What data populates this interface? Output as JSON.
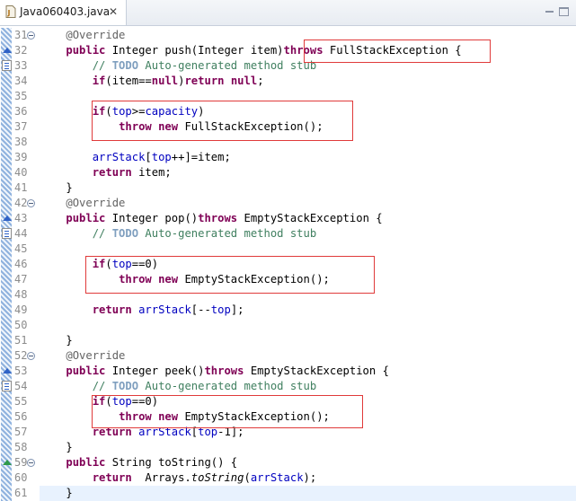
{
  "tab": {
    "title": "Java060403.java",
    "close": "✕"
  },
  "lines": [
    {
      "n": "31",
      "fold": true,
      "tokens": [
        [
          "    ",
          ""
        ],
        [
          "@Override",
          "an"
        ]
      ]
    },
    {
      "n": "32",
      "ovr": "ovr",
      "tokens": [
        [
          "    ",
          ""
        ],
        [
          "public",
          "kw"
        ],
        [
          " Integer push(Integer item)",
          ""
        ],
        [
          "throws",
          "kw"
        ],
        [
          " FullStackException {",
          ""
        ]
      ]
    },
    {
      "n": "33",
      "task": true,
      "tokens": [
        [
          "        ",
          ""
        ],
        [
          "// ",
          "cm"
        ],
        [
          "TODO",
          "td"
        ],
        [
          " Auto-generated method stub",
          "cm"
        ]
      ]
    },
    {
      "n": "34",
      "tokens": [
        [
          "        ",
          ""
        ],
        [
          "if",
          "kw"
        ],
        [
          "(item==",
          ""
        ],
        [
          "null",
          "kw"
        ],
        [
          ")",
          ""
        ],
        [
          "return",
          "kw"
        ],
        [
          " ",
          ""
        ],
        [
          "null",
          "kw"
        ],
        [
          ";",
          ""
        ]
      ]
    },
    {
      "n": "35",
      "tokens": []
    },
    {
      "n": "36",
      "tokens": [
        [
          "        ",
          ""
        ],
        [
          "if",
          "kw"
        ],
        [
          "(",
          ""
        ],
        [
          "top",
          "fd"
        ],
        [
          ">=",
          ""
        ],
        [
          "capacity",
          "fd"
        ],
        [
          ")",
          ""
        ]
      ]
    },
    {
      "n": "37",
      "tokens": [
        [
          "            ",
          ""
        ],
        [
          "throw",
          "kw"
        ],
        [
          " ",
          ""
        ],
        [
          "new",
          "kw"
        ],
        [
          " FullStackException();",
          ""
        ]
      ]
    },
    {
      "n": "38",
      "tokens": []
    },
    {
      "n": "39",
      "tokens": [
        [
          "        ",
          ""
        ],
        [
          "arrStack",
          "fd"
        ],
        [
          "[",
          ""
        ],
        [
          "top",
          "fd"
        ],
        [
          "++]=item;",
          ""
        ]
      ]
    },
    {
      "n": "40",
      "tokens": [
        [
          "        ",
          ""
        ],
        [
          "return",
          "kw"
        ],
        [
          " item;",
          ""
        ]
      ]
    },
    {
      "n": "41",
      "tokens": [
        [
          "    }",
          ""
        ]
      ]
    },
    {
      "n": "42",
      "fold": true,
      "tokens": [
        [
          "    ",
          ""
        ],
        [
          "@Override",
          "an"
        ]
      ]
    },
    {
      "n": "43",
      "ovr": "ovr",
      "tokens": [
        [
          "    ",
          ""
        ],
        [
          "public",
          "kw"
        ],
        [
          " Integer pop()",
          ""
        ],
        [
          "throws",
          "kw"
        ],
        [
          " EmptyStackException {",
          ""
        ]
      ]
    },
    {
      "n": "44",
      "task": true,
      "tokens": [
        [
          "        ",
          ""
        ],
        [
          "// ",
          "cm"
        ],
        [
          "TODO",
          "td"
        ],
        [
          " Auto-generated method stub",
          "cm"
        ]
      ]
    },
    {
      "n": "45",
      "tokens": []
    },
    {
      "n": "46",
      "tokens": [
        [
          "        ",
          ""
        ],
        [
          "if",
          "kw"
        ],
        [
          "(",
          ""
        ],
        [
          "top",
          "fd"
        ],
        [
          "==0)",
          ""
        ]
      ]
    },
    {
      "n": "47",
      "tokens": [
        [
          "            ",
          ""
        ],
        [
          "throw",
          "kw"
        ],
        [
          " ",
          ""
        ],
        [
          "new",
          "kw"
        ],
        [
          " EmptyStackException();",
          ""
        ]
      ]
    },
    {
      "n": "48",
      "tokens": []
    },
    {
      "n": "49",
      "tokens": [
        [
          "        ",
          ""
        ],
        [
          "return",
          "kw"
        ],
        [
          " ",
          ""
        ],
        [
          "arrStack",
          "fd"
        ],
        [
          "[--",
          ""
        ],
        [
          "top",
          "fd"
        ],
        [
          "];",
          ""
        ]
      ]
    },
    {
      "n": "50",
      "tokens": []
    },
    {
      "n": "51",
      "tokens": [
        [
          "    }",
          ""
        ]
      ]
    },
    {
      "n": "52",
      "fold": true,
      "tokens": [
        [
          "    ",
          ""
        ],
        [
          "@Override",
          "an"
        ]
      ]
    },
    {
      "n": "53",
      "ovr": "ovr",
      "tokens": [
        [
          "    ",
          ""
        ],
        [
          "public",
          "kw"
        ],
        [
          " Integer peek()",
          ""
        ],
        [
          "throws",
          "kw"
        ],
        [
          " EmptyStackException {",
          ""
        ]
      ]
    },
    {
      "n": "54",
      "task": true,
      "tokens": [
        [
          "        ",
          ""
        ],
        [
          "// ",
          "cm"
        ],
        [
          "TODO",
          "td"
        ],
        [
          " Auto-generated method stub",
          "cm"
        ]
      ]
    },
    {
      "n": "55",
      "tokens": [
        [
          "        ",
          ""
        ],
        [
          "if",
          "kw"
        ],
        [
          "(",
          ""
        ],
        [
          "top",
          "fd"
        ],
        [
          "==0)",
          ""
        ]
      ]
    },
    {
      "n": "56",
      "tokens": [
        [
          "            ",
          ""
        ],
        [
          "throw",
          "kw"
        ],
        [
          " ",
          ""
        ],
        [
          "new",
          "kw"
        ],
        [
          " EmptyStackException();",
          ""
        ]
      ]
    },
    {
      "n": "57",
      "tokens": [
        [
          "        ",
          ""
        ],
        [
          "return",
          "kw"
        ],
        [
          " ",
          ""
        ],
        [
          "arrStack",
          "fd"
        ],
        [
          "[",
          ""
        ],
        [
          "top",
          "fd"
        ],
        [
          "-1];",
          ""
        ]
      ]
    },
    {
      "n": "58",
      "tokens": [
        [
          "    }",
          ""
        ]
      ]
    },
    {
      "n": "59",
      "fold": true,
      "ovr": "ovr imp",
      "tokens": [
        [
          "    ",
          ""
        ],
        [
          "public",
          "kw"
        ],
        [
          " String toString() {",
          ""
        ]
      ]
    },
    {
      "n": "60",
      "tokens": [
        [
          "        ",
          ""
        ],
        [
          "return",
          "kw"
        ],
        [
          "  Arrays.",
          ""
        ],
        [
          "toString",
          "it"
        ],
        [
          "(",
          ""
        ],
        [
          "arrStack",
          "fd"
        ],
        [
          ");",
          ""
        ]
      ]
    },
    {
      "n": "61",
      "cur": true,
      "tokens": [
        [
          "    }",
          ""
        ]
      ]
    }
  ]
}
